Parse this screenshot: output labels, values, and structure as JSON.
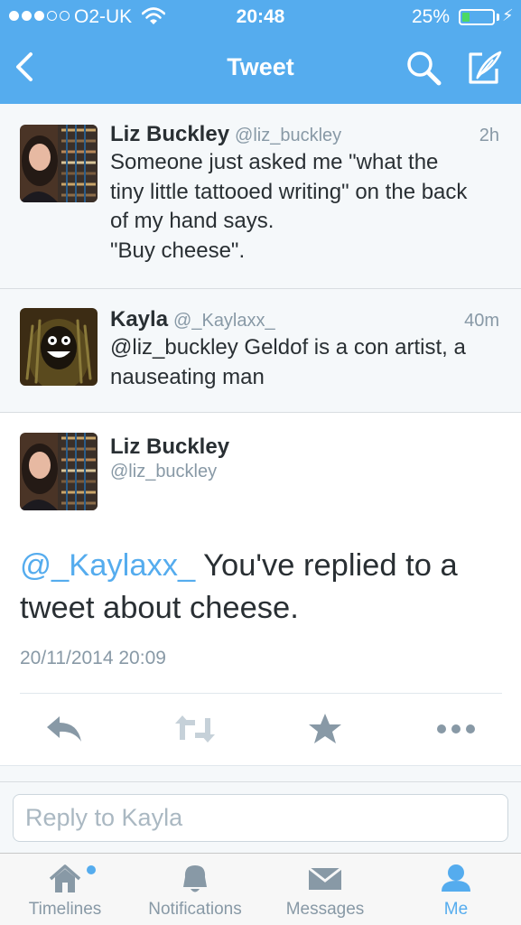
{
  "status_bar": {
    "carrier": "O2-UK",
    "time": "20:48",
    "battery_percent": "25%",
    "battery_level": 0.25,
    "signal_bars": 3,
    "signal_total": 5
  },
  "nav": {
    "title": "Tweet"
  },
  "tweets": [
    {
      "name": "Liz Buckley",
      "handle": "@liz_buckley",
      "time": "2h",
      "lines": [
        "Someone just asked me \"what the",
        "tiny little tattooed writing\" on the back",
        "of my hand says.",
        "\"Buy cheese\"."
      ]
    },
    {
      "name": "Kayla",
      "handle": "@_Kaylaxx_",
      "time": "40m",
      "lines": [
        "@liz_buckley Geldof is a con artist,  a",
        "nauseating man"
      ]
    }
  ],
  "main_tweet": {
    "name": "Liz Buckley",
    "handle": "@liz_buckley",
    "mention": "@_Kaylaxx_",
    "text_after_mention": " You've replied to a",
    "text_line2": "tweet about cheese.",
    "timestamp": "20/11/2014 20:09",
    "actions": [
      "reply-icon",
      "retweet-icon",
      "favorite-icon",
      "more-icon"
    ]
  },
  "reply": {
    "placeholder": "Reply to Kayla"
  },
  "tabs": [
    {
      "label": "Timelines",
      "icon": "home-icon",
      "active": false
    },
    {
      "label": "Notifications",
      "icon": "bell-icon",
      "active": false
    },
    {
      "label": "Messages",
      "icon": "envelope-icon",
      "active": false
    },
    {
      "label": "Me",
      "icon": "person-icon",
      "active": true
    }
  ],
  "colors": {
    "brand": "#55acee",
    "background_light": "#f5f8fa",
    "text": "#292f33",
    "muted": "#8899a6",
    "battery": "#4cd964"
  }
}
